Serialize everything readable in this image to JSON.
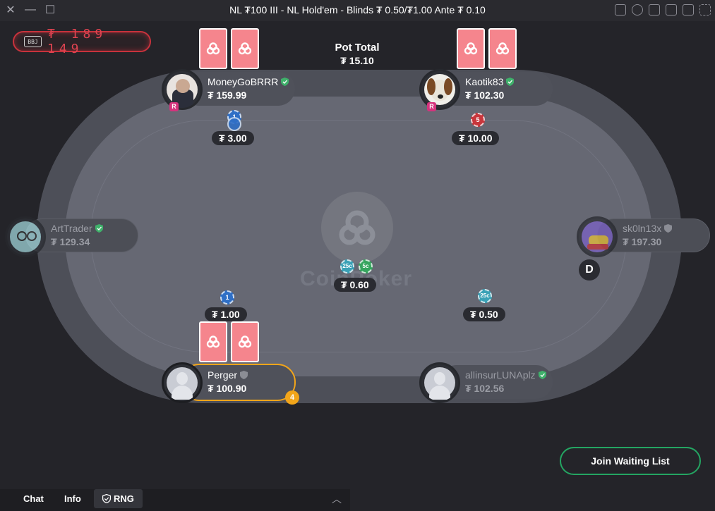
{
  "window": {
    "title": "NL ₮100 III - NL Hold'em - Blinds ₮ 0.50/₮1.00 Ante ₮ 0.10",
    "close_glyph": "✕",
    "minimize_glyph": "—",
    "maximize_glyph": "☐"
  },
  "jackpot": {
    "badge": "BBJ",
    "digits": "₮ 189 149"
  },
  "pot": {
    "label": "Pot Total",
    "value": "₮ 15.10",
    "center_bet": "₮ 0.60",
    "chips": [
      "25c",
      "5c"
    ]
  },
  "logo": {
    "text": "CoinPoker"
  },
  "seats": [
    {
      "name": "MoneyGoBRRR",
      "stack": "₮ 159.99",
      "bet": "₮ 3.00",
      "chip": "1",
      "verified": true,
      "badge": "R"
    },
    {
      "name": "Kaotik83",
      "stack": "₮ 102.30",
      "bet": "₮ 10.00",
      "chip": "5",
      "verified": true,
      "badge": "R"
    },
    {
      "name": "ArtTrader",
      "stack": "₮ 129.34",
      "verified": true
    },
    {
      "name": "sk0ln13x",
      "stack": "₮ 197.30",
      "verified": false
    },
    {
      "name": "Perger",
      "stack": "₮ 100.90",
      "bet": "₮ 1.00",
      "chip": "1",
      "verified": false,
      "timer": "4"
    },
    {
      "name": "allinsurLUNAplz",
      "stack": "₮ 102.56",
      "bet": "₮ 0.50",
      "chip": "25c",
      "verified": true
    }
  ],
  "dealer_button": "D",
  "join_waiting_list": "Join Waiting List",
  "bottom_tabs": {
    "chat": "Chat",
    "info": "Info",
    "rng": "RNG"
  },
  "colors": {
    "accent_green": "#24a562",
    "card_back": "#f5858d",
    "active_ring": "#f2a51a",
    "jackpot_red": "#c8323c"
  },
  "icons": [
    "close-icon",
    "minimize-icon",
    "maximize-icon",
    "layout-icon",
    "history-icon",
    "folder-icon",
    "grid-icon",
    "resize-icon",
    "shield-icon",
    "chevron-up-icon"
  ]
}
